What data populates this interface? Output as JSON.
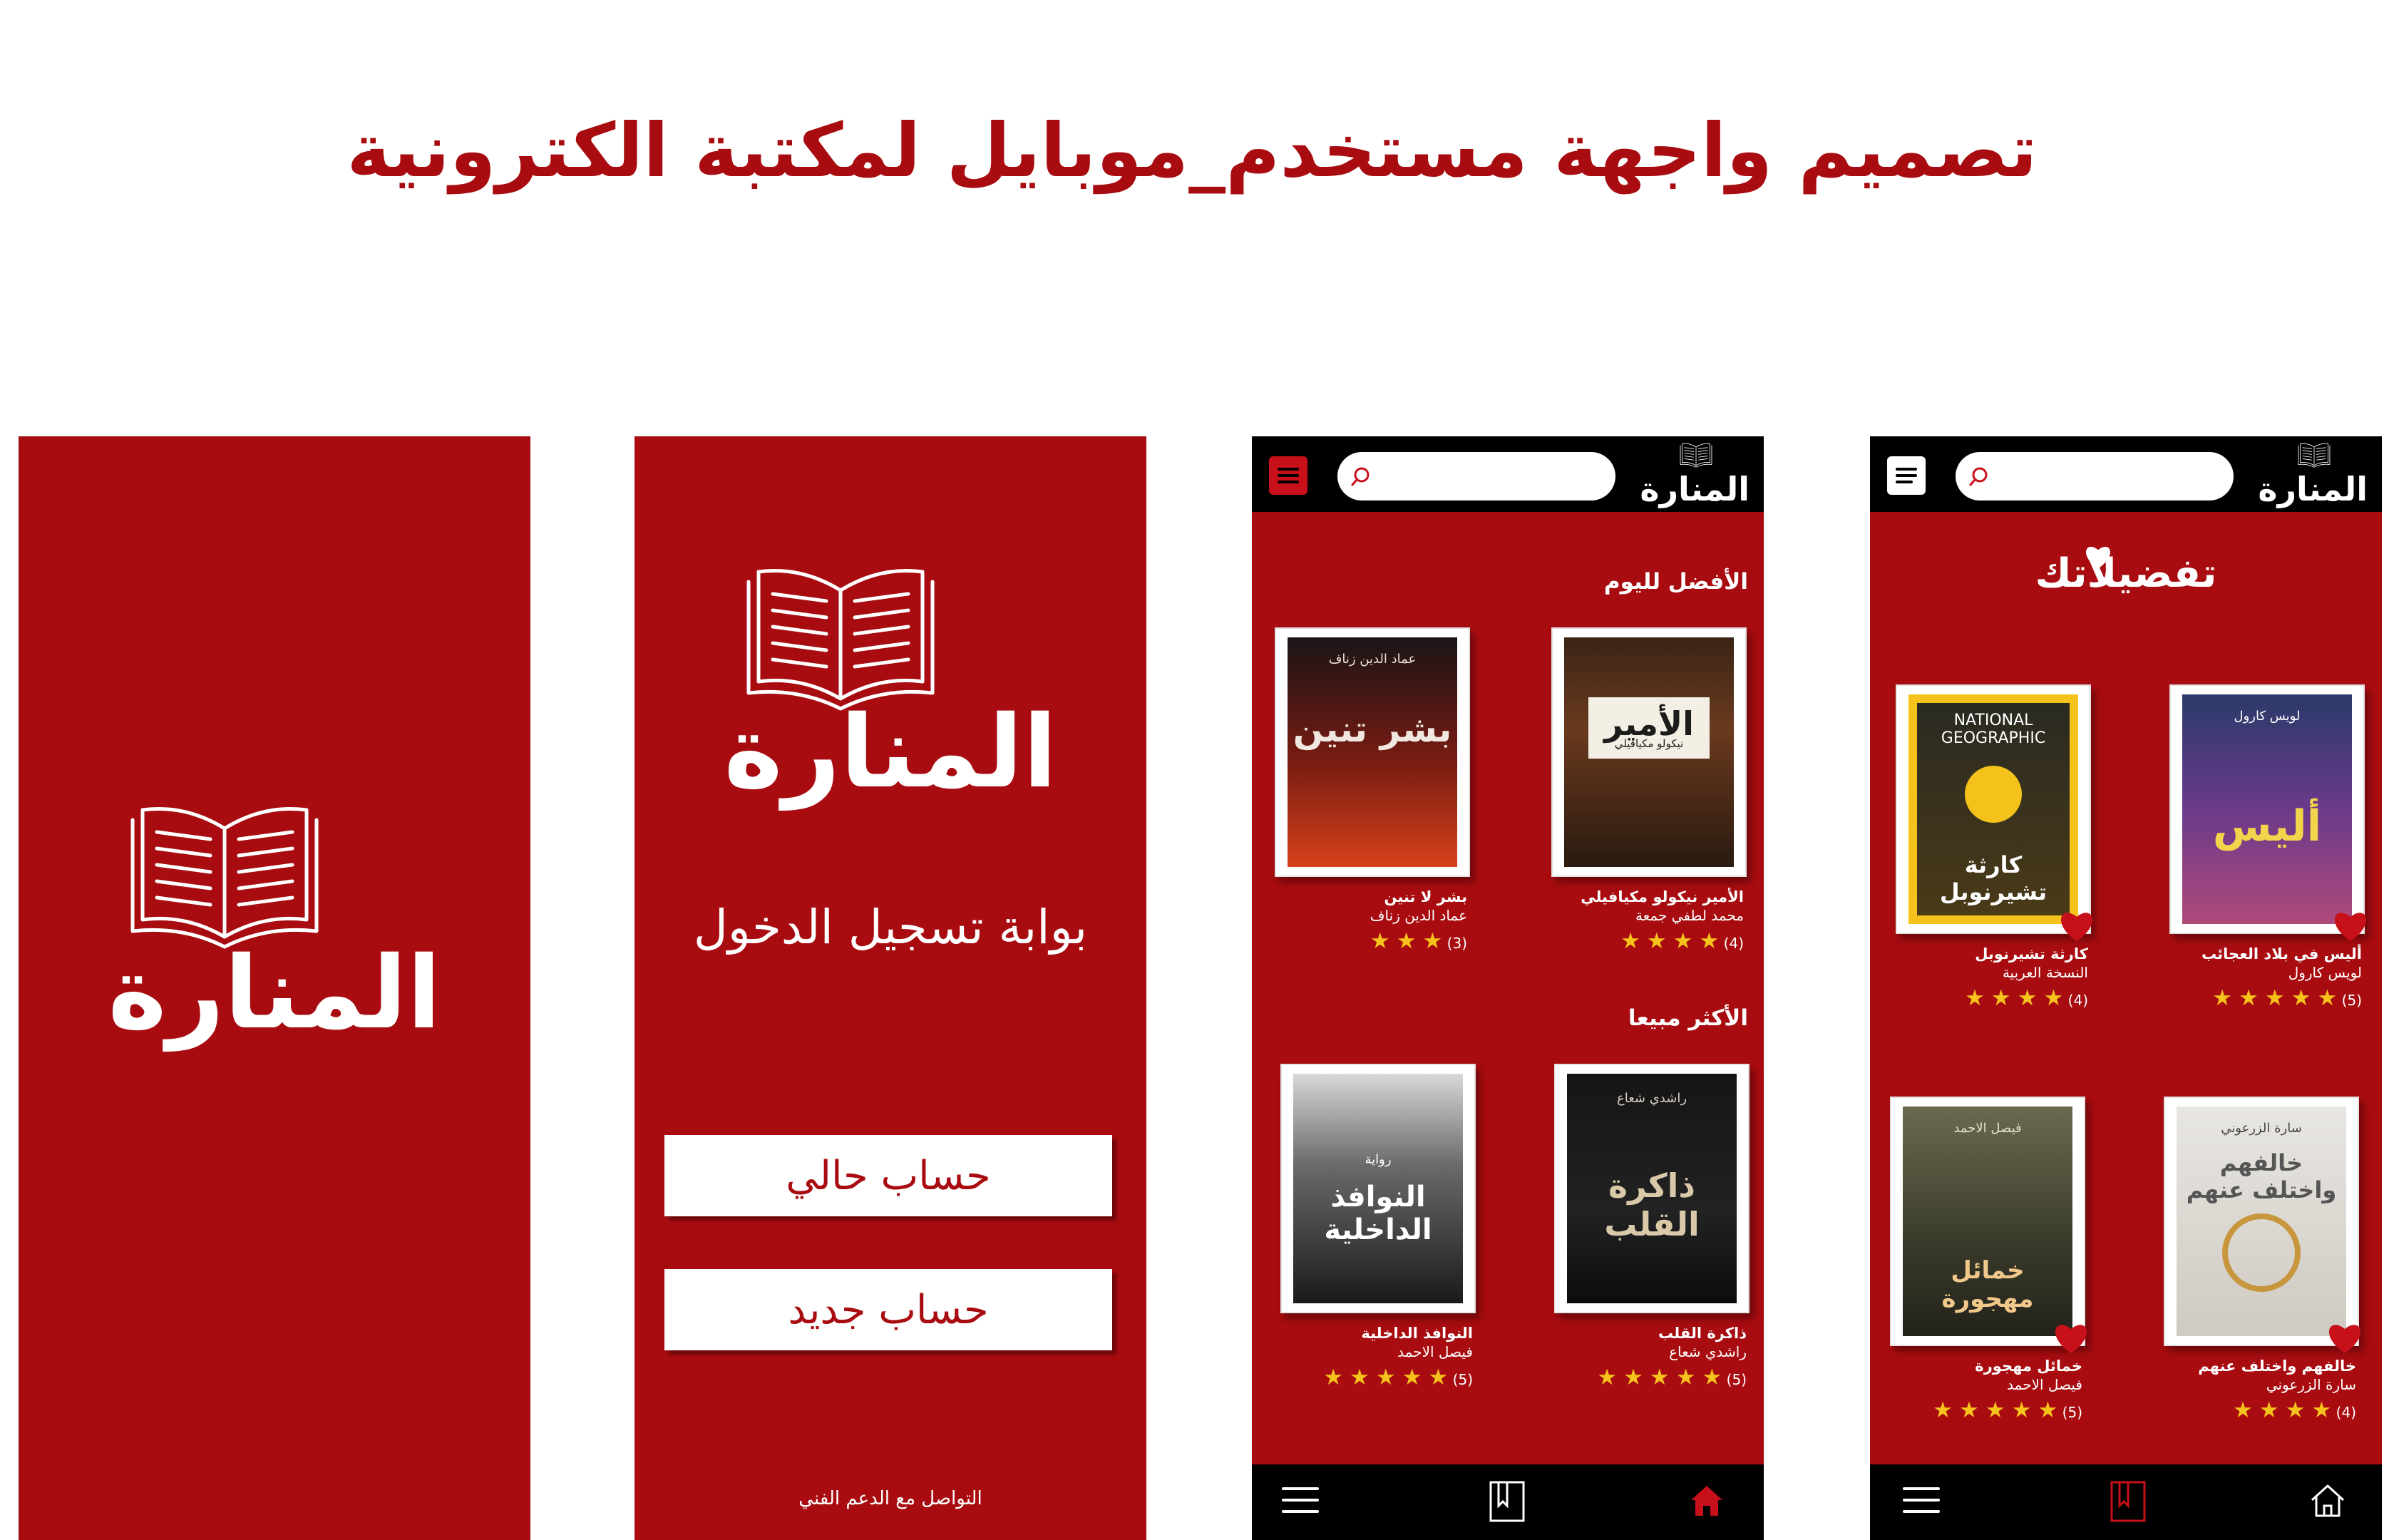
{
  "page_title": "تصميم واجهة مستخدم_موبايل لمكتبة الكترونية",
  "colors": {
    "brand_red": "#a80c10",
    "black": "#000000",
    "white": "#ffffff",
    "star": "#f6c21c"
  },
  "splash": {
    "logo": "المنارة"
  },
  "login": {
    "logo": "المنارة",
    "heading": "بوابة تسجيل الدخول",
    "existing_account": "حساب حالي",
    "new_account": "حساب جديد",
    "support": "التواصل مع الدعم الفني"
  },
  "home": {
    "brand": "المنارة",
    "best_today": "الأفضل لليوم",
    "best_selling": "الأكثر مبيعا",
    "books": [
      {
        "title": "الأمير نيكولو مكيافيلي",
        "author": "محمد لطفي جمعة",
        "rating": "(4)",
        "cover_title": "الأمير",
        "cover_top": "نيكولو مكيافيلي"
      },
      {
        "title": "بشر لا تنين",
        "author": "عماد الدين زناف",
        "rating": "(3)",
        "cover_title": "بشر تنين",
        "cover_top": "عماد الدين زناف"
      },
      {
        "title": "ذاكرة القلب",
        "author": "راشدي شعاع",
        "rating": "(5)",
        "cover_title": "ذاكرة القلب",
        "cover_top": "راشدي شعاع"
      },
      {
        "title": "النوافذ الداخلية",
        "author": "فيصل الاحمد",
        "rating": "(5)",
        "cover_title": "النوافذ الداخلية",
        "cover_top": "رواية"
      }
    ],
    "icons": {
      "home": "home-icon",
      "bookmark": "bookmark-icon",
      "menu": "menu-icon",
      "search": "search-icon"
    }
  },
  "favorites": {
    "brand": "المنارة",
    "title": "تفضيلاتك",
    "books": [
      {
        "title": "أليس في بلاد العجائب",
        "author": "لويس كارول",
        "rating": "(5)",
        "cover_title": "أليس",
        "cover_top": "لويس كارول"
      },
      {
        "title": "كارثة تشيرنوبل",
        "author": "النسخة العربية",
        "rating": "(4)",
        "cover_title": "كارثة تشيرنوبل",
        "cover_top": "NATIONAL GEOGRAPHIC"
      },
      {
        "title": "خالفهم واختلف عنهم",
        "author": "سارة الزرعوني",
        "rating": "(4)",
        "cover_title": "خالفهم واختلف عنهم",
        "cover_top": "سارة الزرعوني"
      },
      {
        "title": "خمائل مهجورة",
        "author": "فيصل الاحمد",
        "rating": "(5)",
        "cover_title": "خمائل مهجورة",
        "cover_top": "فيصل الاحمد"
      }
    ]
  }
}
